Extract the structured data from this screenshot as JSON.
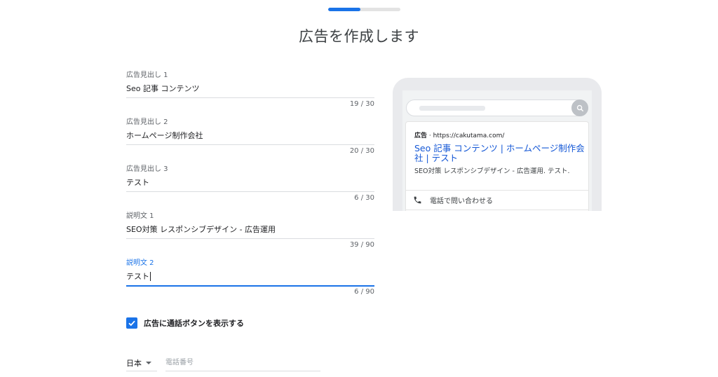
{
  "progress": {
    "value": 0.45
  },
  "page_title": "広告を作成します",
  "fields": [
    {
      "label": "広告見出し 1",
      "value": "Seo 記事 コンテンツ",
      "count": "19 / 30"
    },
    {
      "label": "広告見出し 2",
      "value": "ホームページ制作会社",
      "count": "20 / 30"
    },
    {
      "label": "広告見出し 3",
      "value": "テスト",
      "count": "6 / 30"
    },
    {
      "label": "説明文 1",
      "value": "SEO対策 レスポンシブデザイン - 広告運用",
      "count": "39 / 90"
    },
    {
      "label": "説明文 2",
      "value": "テスト",
      "count": "6 / 90"
    }
  ],
  "call_checkbox": {
    "label": "広告に通話ボタンを表示する",
    "checked": true
  },
  "phone": {
    "country": "日本",
    "placeholder": "電話番号"
  },
  "preview": {
    "ad_badge": "広告",
    "separator": " · ",
    "url": "https://cakutama.com/",
    "headline": "Seo 記事 コンテンツ | ホームページ制作会社 | テスト",
    "description": "SEO対策 レスポンシブデザイン - 広告運用. テスト.",
    "call_label": "電話で問い合わせる"
  },
  "colors": {
    "accent": "#1a73e8",
    "link": "#1558d6",
    "divider": "#dadce0"
  },
  "icons": {
    "check": "check-icon",
    "search": "search-icon",
    "phone": "phone-icon",
    "dropdown": "dropdown-arrow-icon"
  }
}
